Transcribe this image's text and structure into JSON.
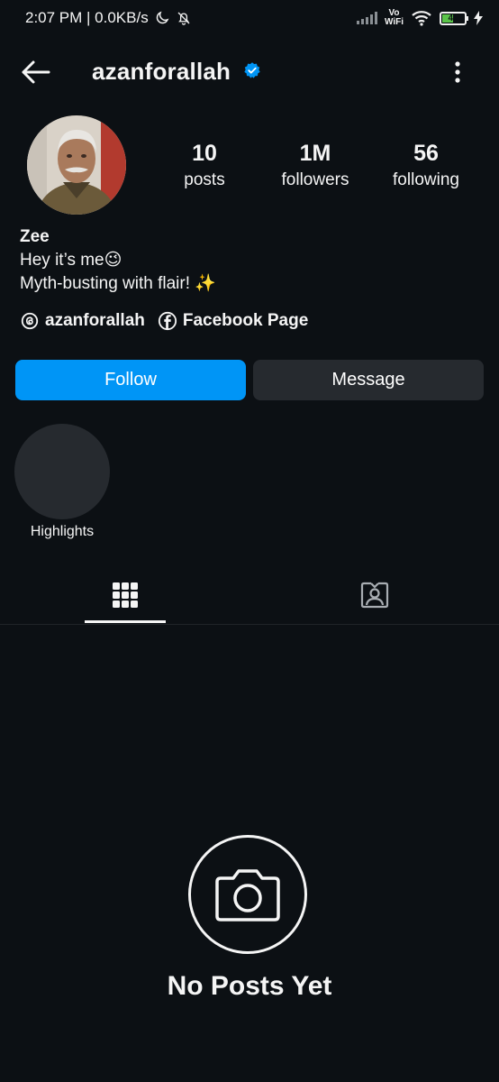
{
  "status_bar": {
    "time_speed": "2:07 PM | 0.0KB/s",
    "vowifi_top": "Vo",
    "vowifi_bottom": "WiFi",
    "battery": "45"
  },
  "header": {
    "username": "azanforallah"
  },
  "profile": {
    "stats": [
      {
        "value": "10",
        "label": "posts"
      },
      {
        "value": "1M",
        "label": "followers"
      },
      {
        "value": "56",
        "label": "following"
      }
    ],
    "name": "Zee",
    "bio_lines": [
      "Hey it’s me😉",
      "Myth-busting with flair! ✨"
    ],
    "links": [
      {
        "label": "azanforallah",
        "icon": "threads-icon"
      },
      {
        "label": "Facebook Page",
        "icon": "facebook-icon"
      }
    ]
  },
  "actions": {
    "follow": "Follow",
    "message": "Message"
  },
  "highlights": {
    "label": "Highlights"
  },
  "tabs": {
    "active": "grid",
    "items": [
      "grid-icon",
      "tagged-icon"
    ]
  },
  "empty_state": {
    "title": "No Posts Yet"
  },
  "colors": {
    "background": "#0c1014",
    "follow_button": "#0095f6",
    "secondary_button": "#262a2f",
    "verified": "#0095f6"
  }
}
